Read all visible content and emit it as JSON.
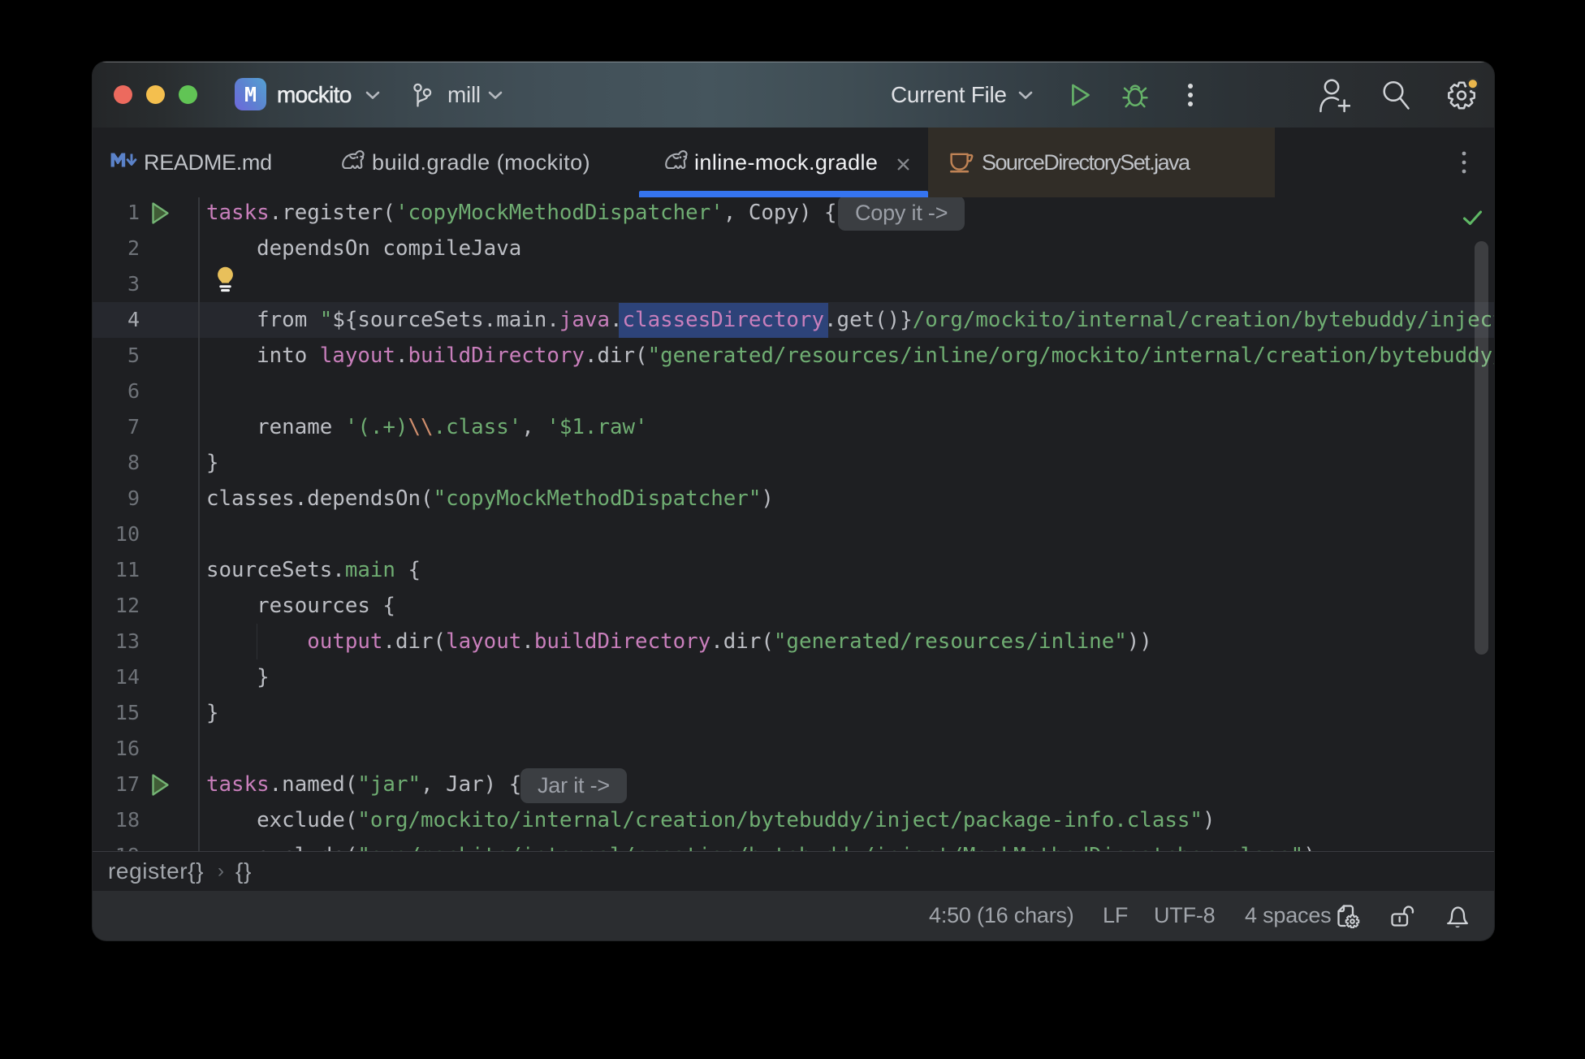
{
  "window": {
    "titlebar": {
      "traffic_lights": [
        "close",
        "minimize",
        "zoom"
      ],
      "project": {
        "initial": "M",
        "name": "mockito"
      },
      "branch": {
        "name": "mill"
      },
      "run_configuration": {
        "label": "Current File"
      },
      "actions": [
        "run",
        "debug",
        "more-options",
        "add-user",
        "search-everywhere",
        "settings"
      ],
      "settings_badge_color": "#ECB95C"
    },
    "tabbar": {
      "tabs": [
        {
          "label": "README.md",
          "icon": "markdown",
          "active": false,
          "closable": false,
          "warm": false
        },
        {
          "label": "build.gradle (mockito)",
          "icon": "gradle",
          "active": false,
          "closable": false,
          "warm": false
        },
        {
          "label": "inline-mock.gradle",
          "icon": "gradle",
          "active": true,
          "closable": true,
          "warm": false
        },
        {
          "label": "SourceDirectorySet.java",
          "icon": "java-class",
          "active": false,
          "closable": false,
          "warm": true
        }
      ],
      "active_underline_color": "#3574F0"
    },
    "editor": {
      "language": "groovy",
      "current_line": 4,
      "selected_text": "classesDirectory",
      "selection_color": "#2D4379",
      "colors": {
        "default": "#BCBEC4",
        "property": "#C97FBC",
        "string": "#6FAD72",
        "escape": "#CF8E6D"
      },
      "inspection_status": "no-problems",
      "lines": [
        {
          "n": 1,
          "run": true,
          "inlay": "Copy it ->",
          "tokens": [
            {
              "c": "p",
              "t": "tasks"
            },
            {
              "c": "d",
              "t": ".register("
            },
            {
              "c": "s",
              "t": "'copyMockMethodDispatcher'"
            },
            {
              "c": "d",
              "t": ", Copy) {"
            }
          ]
        },
        {
          "n": 2,
          "tokens": [
            {
              "c": "d",
              "t": "    dependsOn compileJava"
            }
          ]
        },
        {
          "n": 3,
          "bulb": true,
          "tokens": []
        },
        {
          "n": 4,
          "current": true,
          "tokens": [
            {
              "c": "d",
              "t": "    from "
            },
            {
              "c": "s",
              "t": "\""
            },
            {
              "c": "d",
              "t": "${sourceSets.main."
            },
            {
              "c": "p",
              "t": "java"
            },
            {
              "c": "d",
              "t": "."
            },
            {
              "c": "p",
              "t": "classesDirectory",
              "sel": true
            },
            {
              "c": "d",
              "t": ".get()}"
            },
            {
              "c": "s",
              "t": "/org/mockito/internal/creation/bytebuddy/inject\""
            }
          ]
        },
        {
          "n": 5,
          "tokens": [
            {
              "c": "d",
              "t": "    into "
            },
            {
              "c": "p",
              "t": "layout"
            },
            {
              "c": "d",
              "t": "."
            },
            {
              "c": "p",
              "t": "buildDirectory"
            },
            {
              "c": "d",
              "t": ".dir("
            },
            {
              "c": "s",
              "t": "\"generated/resources/inline/org/mockito/internal/creation/bytebuddy/inject\""
            },
            {
              "c": "d",
              "t": ")"
            }
          ]
        },
        {
          "n": 6,
          "tokens": []
        },
        {
          "n": 7,
          "tokens": [
            {
              "c": "d",
              "t": "    rename "
            },
            {
              "c": "s",
              "t": "'(.+)"
            },
            {
              "c": "e",
              "t": "\\\\"
            },
            {
              "c": "s",
              "t": ".class'"
            },
            {
              "c": "d",
              "t": ", "
            },
            {
              "c": "s",
              "t": "'$1.raw'"
            }
          ]
        },
        {
          "n": 8,
          "tokens": [
            {
              "c": "d",
              "t": "}"
            }
          ]
        },
        {
          "n": 9,
          "tokens": [
            {
              "c": "d",
              "t": "classes.dependsOn("
            },
            {
              "c": "s",
              "t": "\"copyMockMethodDispatcher\""
            },
            {
              "c": "d",
              "t": ")"
            }
          ]
        },
        {
          "n": 10,
          "tokens": []
        },
        {
          "n": 11,
          "tokens": [
            {
              "c": "d",
              "t": "sourceSets."
            },
            {
              "c": "s",
              "t": "main"
            },
            {
              "c": "d",
              "t": " {"
            }
          ]
        },
        {
          "n": 12,
          "tokens": [
            {
              "c": "d",
              "t": "    resources {"
            }
          ]
        },
        {
          "n": 13,
          "tokens": [
            {
              "c": "d",
              "t": "        "
            },
            {
              "c": "p",
              "t": "output"
            },
            {
              "c": "d",
              "t": ".dir("
            },
            {
              "c": "p",
              "t": "layout"
            },
            {
              "c": "d",
              "t": "."
            },
            {
              "c": "p",
              "t": "buildDirectory"
            },
            {
              "c": "d",
              "t": ".dir("
            },
            {
              "c": "s",
              "t": "\"generated/resources/inline\""
            },
            {
              "c": "d",
              "t": "))"
            }
          ]
        },
        {
          "n": 14,
          "tokens": [
            {
              "c": "d",
              "t": "    }"
            }
          ]
        },
        {
          "n": 15,
          "tokens": [
            {
              "c": "d",
              "t": "}"
            }
          ]
        },
        {
          "n": 16,
          "tokens": []
        },
        {
          "n": 17,
          "run": true,
          "inlay": "Jar it ->",
          "tokens": [
            {
              "c": "p",
              "t": "tasks"
            },
            {
              "c": "d",
              "t": ".named("
            },
            {
              "c": "s",
              "t": "\"jar\""
            },
            {
              "c": "d",
              "t": ", Jar) {"
            }
          ]
        },
        {
          "n": 18,
          "tokens": [
            {
              "c": "d",
              "t": "    exclude("
            },
            {
              "c": "s",
              "t": "\"org/mockito/internal/creation/bytebuddy/inject/package-info.class\""
            },
            {
              "c": "d",
              "t": ")"
            }
          ]
        },
        {
          "n": 19,
          "tokens": [
            {
              "c": "d",
              "t": "    exclude("
            },
            {
              "c": "s",
              "t": "\"org/mockito/internal/creation/bytebuddy/inject/MockMethodDispatcher.class\""
            },
            {
              "c": "d",
              "t": ")"
            }
          ]
        }
      ]
    },
    "breadcrumbs": {
      "items": [
        "register{}",
        "{}"
      ],
      "separator": "›"
    },
    "statusbar": {
      "items": [
        {
          "text": "4:50 (16 chars)",
          "kind": "caret-position"
        },
        {
          "text": "LF",
          "kind": "line-separator"
        },
        {
          "text": "UTF-8",
          "kind": "encoding"
        },
        {
          "text": "4 spaces",
          "kind": "indentation"
        }
      ],
      "icons": [
        "file-settings",
        "unlocked",
        "notifications"
      ]
    }
  }
}
